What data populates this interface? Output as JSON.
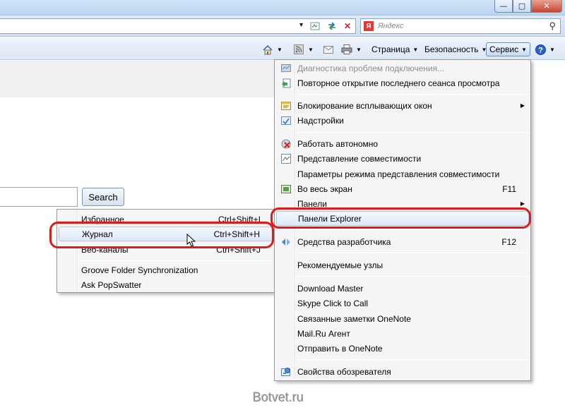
{
  "window": {
    "minimize_glyph": "—",
    "maximize_glyph": "▢",
    "close_glyph": "✕"
  },
  "address_bar": {
    "search_placeholder": "Яндекс",
    "search_provider_letter": "Я"
  },
  "command_bar": {
    "page_label": "Страница",
    "safety_label": "Безопасность",
    "tools_label": "Сервис",
    "help_glyph": "?"
  },
  "page": {
    "search_button_label": "Search"
  },
  "panels_submenu": {
    "items": [
      {
        "label": "Избранное",
        "shortcut": "Ctrl+Shift+I"
      },
      {
        "label": "Журнал",
        "shortcut": "Ctrl+Shift+H"
      },
      {
        "label": "Веб-каналы",
        "shortcut": "Ctrl+Shift+J"
      },
      {
        "label": "Groove Folder Synchronization",
        "shortcut": ""
      },
      {
        "label": "Ask PopSwatter",
        "shortcut": ""
      }
    ]
  },
  "tools_menu": {
    "items": [
      {
        "label": "Диагностика проблем подключения...",
        "shortcut": "",
        "disabled": true,
        "icon": "diagnostics-icon"
      },
      {
        "label": "Повторное открытие последнего сеанса просмотра",
        "shortcut": "",
        "icon": "reopen-session-icon"
      },
      {
        "label": "Блокирование всплывающих окон",
        "shortcut": "",
        "submenu": true,
        "icon": "popup-blocker-icon"
      },
      {
        "label": "Надстройки",
        "shortcut": "",
        "icon": "addons-icon"
      },
      {
        "label": "Работать автономно",
        "shortcut": "",
        "icon": "offline-icon"
      },
      {
        "label": "Представление совместимости",
        "shortcut": "",
        "icon": "compatibility-icon"
      },
      {
        "label": "Параметры режима представления совместимости",
        "shortcut": ""
      },
      {
        "label": "Во весь экран",
        "shortcut": "F11",
        "icon": "fullscreen-icon"
      },
      {
        "label": "Панели",
        "shortcut": "",
        "submenu": true
      },
      {
        "label": "Панели Explorer",
        "shortcut": ""
      },
      {
        "label": "Средства разработчика",
        "shortcut": "F12",
        "icon": "developer-tools-icon"
      },
      {
        "label": "Рекомендуемые узлы",
        "shortcut": ""
      },
      {
        "label": "Download Master",
        "shortcut": ""
      },
      {
        "label": "Skype Click to Call",
        "shortcut": ""
      },
      {
        "label": "Связанные заметки OneNote",
        "shortcut": ""
      },
      {
        "label": "Mail.Ru Агент",
        "shortcut": ""
      },
      {
        "label": "Отправить в OneNote",
        "shortcut": ""
      },
      {
        "label": "Свойства обозревателя",
        "shortcut": "",
        "icon": "internet-options-icon"
      }
    ]
  },
  "watermark": "Botvet.ru",
  "colors": {
    "highlight_oval": "#e01a1a",
    "menu_background": "#f5f5f5"
  }
}
